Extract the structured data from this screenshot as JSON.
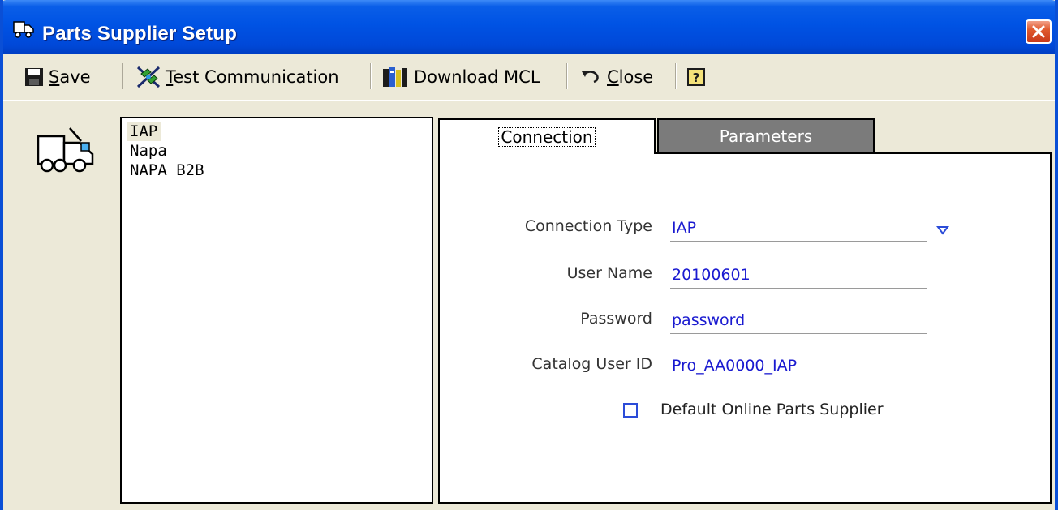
{
  "window": {
    "title": "Parts Supplier Setup",
    "title_icon": "truck-icon",
    "close_icon": "close-icon"
  },
  "toolbar": {
    "save": {
      "label": "Save",
      "mnemonic": "S",
      "rest": "ave",
      "icon": "floppy-disk-icon"
    },
    "test_communication": {
      "label": "Test Communication",
      "mnemonic": "T",
      "rest": "est Communication",
      "icon": "satellite-icon"
    },
    "download_mcl": {
      "label": "Download MCL",
      "icon": "books-icon"
    },
    "close": {
      "label": "Close",
      "mnemonic": "C",
      "rest": "lose",
      "icon": "undo-arrow-icon"
    },
    "help": {
      "icon": "help-icon",
      "label": "?"
    }
  },
  "suppliers": {
    "items": [
      "IAP",
      "Napa",
      "NAPA B2B"
    ],
    "selected": "IAP"
  },
  "tabs": {
    "connection": "Connection",
    "parameters": "Parameters",
    "active": "Connection"
  },
  "form": {
    "connection_type": {
      "label": "Connection Type",
      "value": "IAP"
    },
    "user_name": {
      "label": "User Name",
      "value": "20100601"
    },
    "password": {
      "label": "Password",
      "value": "password"
    },
    "catalog_user_id": {
      "label": "Catalog User ID",
      "value": "Pro_AA0000_IAP"
    },
    "default_supplier": {
      "label": "Default Online Parts Supplier",
      "checked": false
    }
  },
  "colors": {
    "titlebar": "#0053e4",
    "window_bg": "#ece9d8",
    "value_text": "#1a1ad0",
    "tab_inactive": "#7b7b7b"
  }
}
